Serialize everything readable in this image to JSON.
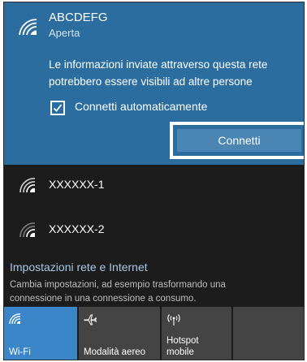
{
  "selected_network": {
    "name": "ABCDEFG",
    "status": "Aperta",
    "warning": "Le informazioni inviate attraverso questa rete potrebbero essere visibili ad altre persone",
    "auto_connect_label": "Connetti automaticamente",
    "auto_connect_checked": true,
    "connect_label": "Connetti"
  },
  "other_networks": [
    {
      "name": "XXXXXX-1"
    },
    {
      "name": "XXXXXX-2"
    }
  ],
  "settings": {
    "title": "Impostazioni rete e Internet",
    "description": "Cambia impostazioni, ad esempio trasformando una connessione in una connessione a consumo."
  },
  "quick_actions": [
    {
      "label": "Wi-Fi",
      "icon": "wifi-icon",
      "active": true
    },
    {
      "label": "Modalità aereo",
      "icon": "airplane-icon",
      "active": false
    },
    {
      "label": "Hotspot mobile",
      "label_line1": "Hotspot",
      "label_line2": "mobile",
      "icon": "hotspot-icon",
      "active": false
    }
  ],
  "colors": {
    "accent": "#2a6d9e",
    "button": "#4a85b3",
    "panel": "#1c1c1c",
    "tile_active": "#3a86c8",
    "tile": "#444444"
  }
}
